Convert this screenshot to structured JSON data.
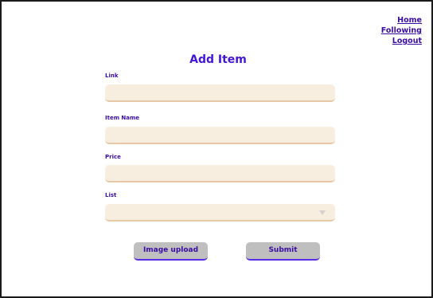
{
  "nav": {
    "home": "Home",
    "following": "Following",
    "logout": "Logout"
  },
  "page": {
    "title": "Add Item"
  },
  "form": {
    "link": {
      "label": "Link",
      "value": "",
      "placeholder": ""
    },
    "item_name": {
      "label": "Item Name",
      "value": "",
      "placeholder": ""
    },
    "price": {
      "label": "Price",
      "value": "",
      "placeholder": ""
    },
    "list": {
      "label": "List",
      "selected": ""
    }
  },
  "buttons": {
    "image_upload": "Image upload",
    "submit": "Submit"
  },
  "colors": {
    "accent": "#4415d6",
    "link": "#3a0ca3",
    "field_bg": "#f8eee0",
    "field_border": "#e8c9a6",
    "button_bg": "#bfbfbf"
  }
}
